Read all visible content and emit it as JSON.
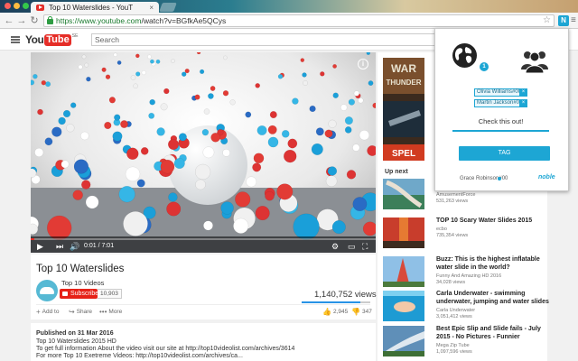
{
  "browser": {
    "tab_title": "Top 10 Waterslides - YouT",
    "tab_close": "×",
    "url_host": "https://www.youtube.com",
    "url_path": "/watch?v=BGfkAe5QCys",
    "back": "←",
    "forward": "→",
    "reload": "↻",
    "star": "☆",
    "extension_label": "N",
    "menu": "≡"
  },
  "youtube": {
    "logo_you": "You",
    "logo_tube": "Tube",
    "logo_region": "SE",
    "search_placeholder": "Search"
  },
  "player": {
    "time_current": "0:01",
    "time_total": "7:01",
    "time_display": "0:01 / 7:01",
    "progress_fraction": 0.003,
    "info_label": "i",
    "colors": {
      "progress": "#e52d27"
    }
  },
  "video": {
    "title": "Top 10 Waterslides",
    "channel": "Top 10 Videos",
    "subscribe_label": "Subscribe",
    "subscriber_count": "10,903",
    "views": "1,140,752 views",
    "like_ratio": 0.86,
    "likes": "2,945",
    "dislikes": "347",
    "actions": {
      "add_to": "Add to",
      "share": "Share",
      "more": "More"
    }
  },
  "description": {
    "published": "Published on 31 Mar 2016",
    "lines": [
      "Top 10 Waterslides 2015 HD",
      "To get full information About the video visit our site at http://top10videolist.com/archives/3614",
      "For more Top 10 Exetreme Videos: http://top10videolist.com/archives/ca..."
    ]
  },
  "sidebar": {
    "up_next": "Up next",
    "items": [
      {
        "title": "",
        "channel": "AmusementForce",
        "views": "531,263 views",
        "duration": ""
      },
      {
        "title": "TOP 10 Scary Water Slides 2015",
        "channel": "ecbo",
        "views": "735,354 views",
        "duration": ""
      },
      {
        "title": "Buzz: This is the highest inflatable water slide in the world?",
        "channel": "Funny And Amazing HD 2016",
        "views": "34,028 views",
        "duration": ""
      },
      {
        "title": "Carla Underwater - swimming underwater, jumping and water slides",
        "channel": "Carla Underwater",
        "views": "3,051,412 views",
        "duration": ""
      },
      {
        "title": "Best Epic Slip and Slide fails - July 2015 - No Pictures - Funnier",
        "channel": "Mega Zip Tube",
        "views": "1,097,596 views",
        "duration": ""
      }
    ]
  },
  "ad": {
    "text_top": "WAR",
    "text_mid": "THUNDER",
    "text_bottom": "SPEL"
  },
  "popup": {
    "globe_badge": "1",
    "tags": [
      "Olivia Williams#00",
      "Martin Jackson#00"
    ],
    "chip_remove": "×",
    "comment": "Check this out!",
    "tag_button": "TAG",
    "user": "Grace Robinson#00",
    "brand": "noble",
    "colors": {
      "accent": "#1da6d4"
    }
  }
}
